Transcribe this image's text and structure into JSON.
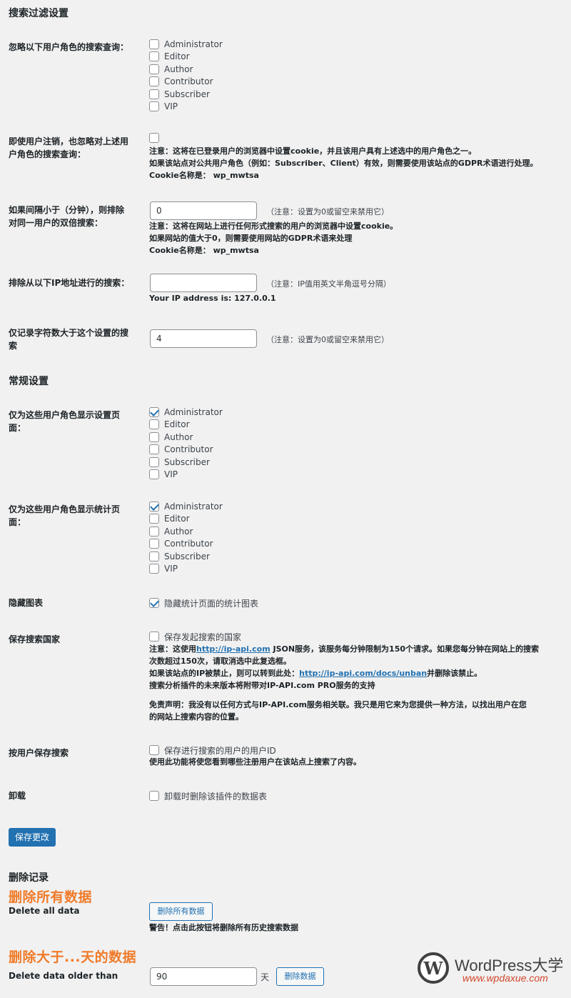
{
  "filter_section": {
    "title": "搜索过滤设置"
  },
  "roles": [
    "Administrator",
    "Editor",
    "Author",
    "Contributor",
    "Subscriber",
    "VIP"
  ],
  "ignore_roles": {
    "label": "忽略以下用户角色的搜索查询：",
    "checked": [
      false,
      false,
      false,
      false,
      false,
      false
    ]
  },
  "ignore_logged_out": {
    "label_line1": "即使用户注销，也忽略对上述用",
    "label_line2": "户角色的搜索查询：",
    "checked": false,
    "note1": "注意：这将在已登录用户的浏览器中设置cookie，并且该用户具有上述选中的用户角色之一。",
    "note2": "如果该站点对公共用户角色（例如：Subscriber、Client）有效，则需要使用该站点的GDPR术语进行处理。",
    "note3": "Cookie名称是：  wp_mwtsa"
  },
  "double_search": {
    "label_line1": "如果间隔小于（分钟），则排除",
    "label_line2": "对同一用户的双倍搜索：",
    "value": "0",
    "hint": "（注意：设置为0或留空来禁用它）",
    "note1": "注意：这将在网站上进行任何形式搜索的用户的浏览器中设置cookie。",
    "note2": "如果网站的值大于0，则需要使用网站的GDPR术语来处理",
    "note3": "Cookie名称是：  wp_mwtsa"
  },
  "exclude_ip": {
    "label": "排除从以下IP地址进行的搜索：",
    "value": "",
    "hint": "（注意：IP值用英文半角逗号分隔）",
    "note": "Your IP address is: 127.0.0.1"
  },
  "min_chars": {
    "label_line1": "仅记录字符数大于这个设置的搜",
    "label_line2": "索",
    "value": "4",
    "hint": "（注意：设置为0或留空来禁用它）"
  },
  "general_section": {
    "title": "常规设置"
  },
  "settings_roles": {
    "label_line1": "仅为这些用户角色显示设置页",
    "label_line2": "面：",
    "checked": [
      true,
      false,
      false,
      false,
      false,
      false
    ]
  },
  "stats_roles": {
    "label_line1": "仅为这些用户角色显示统计页",
    "label_line2": "面：",
    "checked": [
      true,
      false,
      false,
      false,
      false,
      false
    ]
  },
  "hide_charts": {
    "label": "隐藏图表",
    "option": "隐藏统计页面的统计图表",
    "checked": true
  },
  "save_country": {
    "label": "保存搜索国家",
    "option": "保存发起搜索的国家",
    "checked": false,
    "note1_pre": "注意：这使用",
    "note1_link": "http://ip-api.com",
    "note1_post": " JSON服务，该服务每分钟限制为150个请求。如果您每分钟在网站上的搜索",
    "note2": "次数超过150次，请取消选中此复选框。",
    "note3_pre": "如果该站点的IP被禁止，则可以转到此处：",
    "note3_link": "http://ip-api.com/docs/unban",
    "note3_post": "并删除该禁止。",
    "note4": "搜索分析插件的未来版本将附带对IP-API.com PRO服务的支持",
    "disclaimer1": "免责声明：我没有以任何方式与IP-API.com服务相关联。我只是用它来为您提供一种方法，以找出用户在您",
    "disclaimer2": "的网站上搜索内容的位置。"
  },
  "save_user": {
    "label": "按用户保存搜索",
    "option": "保存进行搜索的用户的用户ID",
    "checked": false,
    "note": "使用此功能将使您看到哪些注册用户在该站点上搜索了内容。"
  },
  "uninstall": {
    "label": "卸载",
    "option": "卸载时删除该插件的数据表",
    "checked": false
  },
  "save_button": "保存更改",
  "delete_section": {
    "title": "删除记录",
    "overlay_all": "删除所有数据",
    "all_label": "Delete all data",
    "all_button": "删除所有数据",
    "all_warning": "警告！点击此按钮将删除所有历史搜索数据",
    "overlay_older": "删除大于...天的数据",
    "older_label": "Delete data older than",
    "older_value": "90",
    "older_unit": "天",
    "older_button": "删除数据"
  },
  "watermark": {
    "title": "WordPress大学",
    "url": "www.wpdaxue.com",
    "logo_letter": "W"
  }
}
